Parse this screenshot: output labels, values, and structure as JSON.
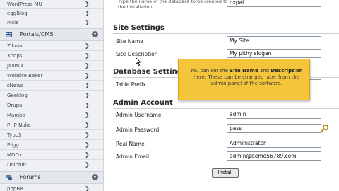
{
  "sidebar": {
    "top_items": [
      {
        "label": "WordPress MU"
      },
      {
        "label": "eggBlog"
      },
      {
        "label": "Pixie"
      }
    ],
    "section_portals": {
      "label": "Portals/CMS",
      "icon": "cms-icon"
    },
    "portal_items": [
      {
        "label": "Zikula"
      },
      {
        "label": "Xoops"
      },
      {
        "label": "Joomla"
      },
      {
        "label": "Website Baker"
      },
      {
        "label": "sNews"
      },
      {
        "label": "Geeklog"
      },
      {
        "label": "Drupal"
      },
      {
        "label": "Mambo"
      },
      {
        "label": "PHP-Nuke"
      },
      {
        "label": "Typo3"
      },
      {
        "label": "Pligg"
      },
      {
        "label": "MODx"
      },
      {
        "label": "Dolphin"
      }
    ],
    "section_forums": {
      "label": "Forums",
      "icon": "forums-icon"
    },
    "forum_items": [
      {
        "label": "phpBB"
      }
    ]
  },
  "main": {
    "db_description": "Type the name of the database to be created for the installation",
    "db_name_value": "oxpal",
    "site_settings": {
      "header": "Site Settings",
      "site_name_label": "Site Name",
      "site_name_value": "My Site",
      "site_description_label": "Site Description",
      "site_description_value": "My pithy slogan"
    },
    "database_settings": {
      "header": "Database Settings",
      "table_prefix_label": "Table Prefix"
    },
    "admin_account": {
      "header": "Admin Account",
      "username_label": "Admin Username",
      "username_value": "admin",
      "password_label": "Admin Password",
      "password_value": "pass",
      "realname_label": "Real Name",
      "realname_value": "Administrator",
      "email_label": "Admin Email",
      "email_value": "admin@demo56789.com"
    },
    "install_label": "Install"
  },
  "tooltip": {
    "pre": "You can set the ",
    "bold1": "Site Name",
    "mid": " and ",
    "bold2": "Description",
    "post": " here. These can be changed later from the admin panel of the software."
  },
  "colors": {
    "sidebar_bg": "#eef0f3",
    "tooltip_bg": "#f4c53b",
    "accent_text": "#2a2a2a"
  }
}
